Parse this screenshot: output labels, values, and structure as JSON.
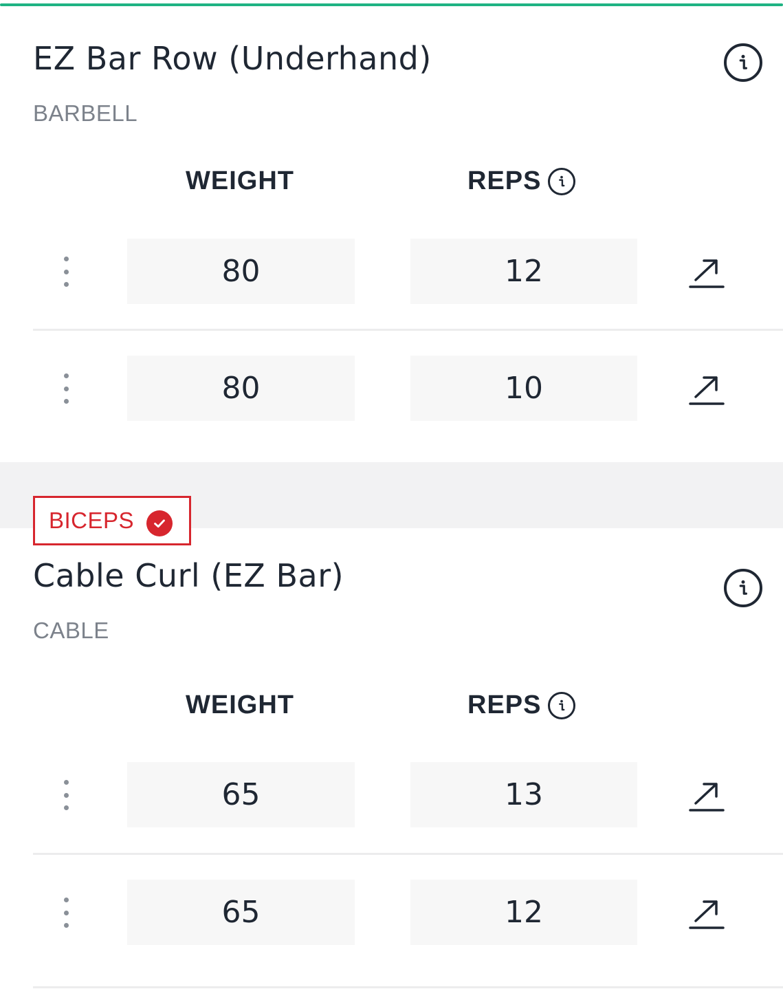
{
  "colors": {
    "accent": "#1fb383",
    "text": "#1f2733",
    "muted": "#7c828b",
    "tag_red": "#d7262e",
    "input_bg": "#f7f7f7"
  },
  "exercises": [
    {
      "name": "EZ Bar Row (Underhand)",
      "equipment": "BARBELL",
      "columns": {
        "weight": "WEIGHT",
        "reps": "REPS"
      },
      "sets": [
        {
          "weight": "80",
          "reps": "12"
        },
        {
          "weight": "80",
          "reps": "10"
        }
      ]
    },
    {
      "muscle_tag": "BICEPS",
      "muscle_tag_checked": true,
      "name": "Cable Curl (EZ Bar)",
      "equipment": "CABLE",
      "columns": {
        "weight": "WEIGHT",
        "reps": "REPS"
      },
      "sets": [
        {
          "weight": "65",
          "reps": "13"
        },
        {
          "weight": "65",
          "reps": "12"
        }
      ]
    }
  ],
  "icons": {
    "info": "info-icon",
    "expand": "arrow-up-right-icon",
    "drag": "drag-handle-icon",
    "check": "check-icon"
  }
}
